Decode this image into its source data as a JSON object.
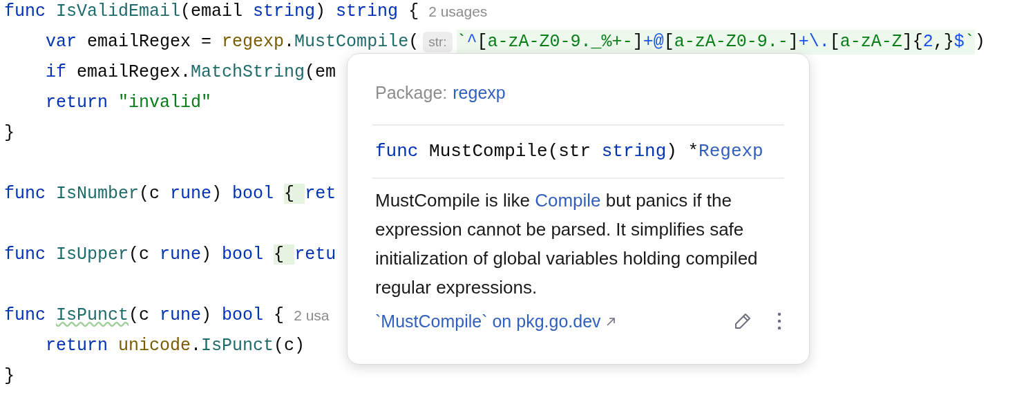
{
  "editor": {
    "lines": [
      {
        "kind": "code",
        "parts": [
          {
            "kind": "code",
            "tokens": [
              {
                "text": "func ",
                "kind": "keyword"
              },
              {
                "text": "IsValidEmail",
                "kind": "function"
              },
              {
                "text": "(email ",
                "kind": "plain"
              },
              {
                "text": "string",
                "kind": "keyword"
              },
              {
                "text": ") ",
                "kind": "plain"
              },
              {
                "text": "string",
                "kind": "keyword"
              },
              {
                "text": " {",
                "kind": "plain"
              }
            ]
          },
          {
            "kind": "usage-hint",
            "text": "2 usages"
          }
        ]
      },
      {
        "kind": "code",
        "parts": [
          {
            "kind": "code",
            "tokens": [
              {
                "text": "    var",
                "kind": "keyword"
              },
              {
                "text": " emailRegex = ",
                "kind": "plain"
              },
              {
                "text": "regexp",
                "kind": "package"
              },
              {
                "text": ".",
                "kind": "plain"
              },
              {
                "text": "MustCompile",
                "kind": "function"
              },
              {
                "text": "(",
                "kind": "plain"
              }
            ]
          },
          {
            "kind": "param-hint",
            "text": "str:"
          },
          {
            "kind": "injected",
            "tokens": [
              {
                "text": "`",
                "kind": "string"
              },
              {
                "text": "^",
                "kind": "regex-op"
              },
              {
                "text": "[",
                "kind": "plain"
              },
              {
                "text": "a-zA-Z0-9._%+-",
                "kind": "string"
              },
              {
                "text": "]",
                "kind": "plain"
              },
              {
                "text": "+@",
                "kind": "regex-op"
              },
              {
                "text": "[",
                "kind": "plain"
              },
              {
                "text": "a-zA-Z0-9.-",
                "kind": "string"
              },
              {
                "text": "]",
                "kind": "plain"
              },
              {
                "text": "+\\.",
                "kind": "regex-op"
              },
              {
                "text": "[",
                "kind": "plain"
              },
              {
                "text": "a-zA-Z",
                "kind": "string"
              },
              {
                "text": "]{",
                "kind": "plain"
              },
              {
                "text": "2",
                "kind": "number"
              },
              {
                "text": ",}",
                "kind": "plain"
              },
              {
                "text": "$",
                "kind": "regex-op"
              },
              {
                "text": "`",
                "kind": "string"
              }
            ]
          },
          {
            "kind": "code",
            "tokens": [
              {
                "text": ")",
                "kind": "plain"
              }
            ]
          }
        ]
      },
      {
        "kind": "code",
        "parts": [
          {
            "kind": "code",
            "tokens": [
              {
                "text": "    if",
                "kind": "keyword"
              },
              {
                "text": " emailRegex.",
                "kind": "plain"
              },
              {
                "text": "MatchString",
                "kind": "function"
              },
              {
                "text": "(em",
                "kind": "plain"
              }
            ]
          }
        ]
      },
      {
        "kind": "code",
        "parts": [
          {
            "kind": "code",
            "tokens": [
              {
                "text": "    return ",
                "kind": "keyword"
              },
              {
                "text": "\"invalid\"",
                "kind": "string"
              }
            ]
          }
        ]
      },
      {
        "kind": "code",
        "parts": [
          {
            "kind": "code",
            "tokens": [
              {
                "text": "}",
                "kind": "plain"
              }
            ]
          }
        ]
      },
      {
        "kind": "blank"
      },
      {
        "kind": "code",
        "parts": [
          {
            "kind": "code",
            "tokens": [
              {
                "text": "func ",
                "kind": "keyword"
              },
              {
                "text": "IsNumber",
                "kind": "function"
              },
              {
                "text": "(c ",
                "kind": "plain"
              },
              {
                "text": "rune",
                "kind": "keyword"
              },
              {
                "text": ") ",
                "kind": "plain"
              },
              {
                "text": "bool ",
                "kind": "keyword"
              },
              {
                "text": "{ ",
                "kind": "brace-match"
              },
              {
                "text": "ret",
                "kind": "keyword"
              }
            ]
          }
        ]
      },
      {
        "kind": "blank"
      },
      {
        "kind": "code",
        "parts": [
          {
            "kind": "code",
            "tokens": [
              {
                "text": "func ",
                "kind": "keyword"
              },
              {
                "text": "IsUpper",
                "kind": "function"
              },
              {
                "text": "(c ",
                "kind": "plain"
              },
              {
                "text": "rune",
                "kind": "keyword"
              },
              {
                "text": ") ",
                "kind": "plain"
              },
              {
                "text": "bool ",
                "kind": "keyword"
              },
              {
                "text": "{ ",
                "kind": "brace-match"
              },
              {
                "text": "retu",
                "kind": "keyword"
              }
            ]
          }
        ]
      },
      {
        "kind": "blank"
      },
      {
        "kind": "code",
        "parts": [
          {
            "kind": "code",
            "tokens": [
              {
                "text": "func ",
                "kind": "keyword"
              },
              {
                "text": "IsPunct",
                "kind": "function-typo"
              },
              {
                "text": "(c ",
                "kind": "plain"
              },
              {
                "text": "rune",
                "kind": "keyword"
              },
              {
                "text": ") ",
                "kind": "plain"
              },
              {
                "text": "bool",
                "kind": "keyword"
              },
              {
                "text": " {",
                "kind": "plain"
              }
            ]
          },
          {
            "kind": "usage-hint",
            "text": "2 usa"
          }
        ]
      },
      {
        "kind": "code",
        "parts": [
          {
            "kind": "code",
            "tokens": [
              {
                "text": "    return ",
                "kind": "keyword"
              },
              {
                "text": "unicode",
                "kind": "package"
              },
              {
                "text": ".",
                "kind": "plain"
              },
              {
                "text": "IsPunct",
                "kind": "function"
              },
              {
                "text": "(c)",
                "kind": "plain"
              }
            ]
          }
        ]
      },
      {
        "kind": "code",
        "parts": [
          {
            "kind": "code",
            "tokens": [
              {
                "text": "}",
                "kind": "plain"
              }
            ]
          }
        ]
      }
    ]
  },
  "doc_popup": {
    "package_label": "Package:",
    "package": "regexp",
    "signature": [
      {
        "text": "func",
        "kind": "keyword"
      },
      {
        "text": " MustCompile(str ",
        "kind": "plain"
      },
      {
        "text": "string",
        "kind": "keyword"
      },
      {
        "text": ") *",
        "kind": "plain"
      },
      {
        "text": "Regexp",
        "kind": "type-link"
      }
    ],
    "description": [
      {
        "text": "MustCompile is like ",
        "kind": "text"
      },
      {
        "text": "Compile",
        "kind": "link"
      },
      {
        "text": " but panics if the expression cannot be parsed. It simplifies safe initialization of global variables holding compiled regular expressions.",
        "kind": "text"
      }
    ],
    "external_link": "`MustCompile` on pkg.go.dev"
  }
}
